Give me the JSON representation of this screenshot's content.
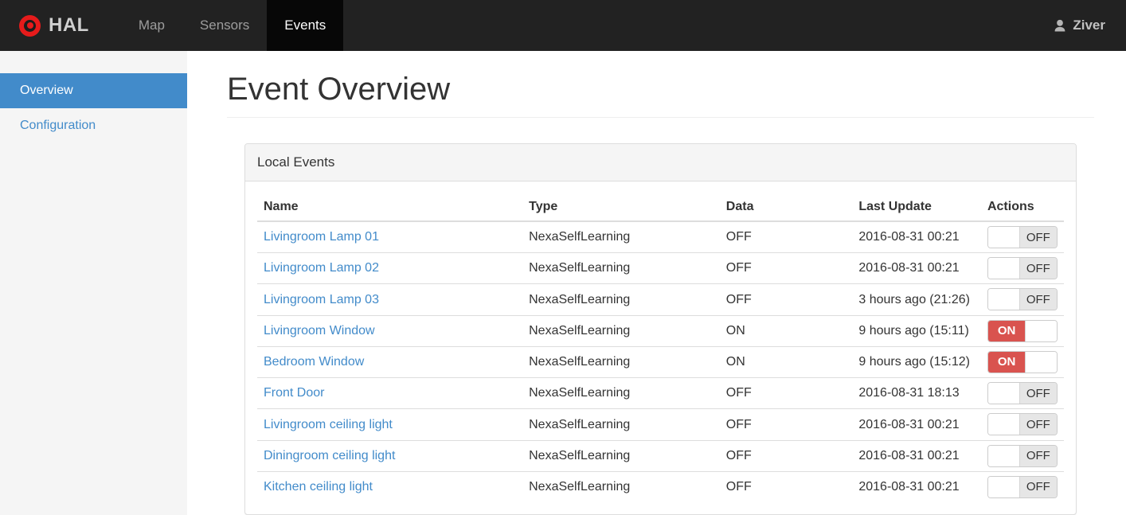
{
  "navbar": {
    "brand": "HAL",
    "items": [
      {
        "label": "Map",
        "active": false
      },
      {
        "label": "Sensors",
        "active": false
      },
      {
        "label": "Events",
        "active": true
      }
    ],
    "user": "Ziver"
  },
  "sidebar": {
    "items": [
      {
        "label": "Overview",
        "active": true
      },
      {
        "label": "Configuration",
        "active": false
      }
    ]
  },
  "main": {
    "title": "Event Overview",
    "panel": {
      "title": "Local Events",
      "table": {
        "headers": [
          "Name",
          "Type",
          "Data",
          "Last Update",
          "Actions"
        ],
        "rows": [
          {
            "name": "Livingroom Lamp 01",
            "type": "NexaSelfLearning",
            "data": "OFF",
            "last_update": "2016-08-31 00:21",
            "switch": "OFF"
          },
          {
            "name": "Livingroom Lamp 02",
            "type": "NexaSelfLearning",
            "data": "OFF",
            "last_update": "2016-08-31 00:21",
            "switch": "OFF"
          },
          {
            "name": "Livingroom Lamp 03",
            "type": "NexaSelfLearning",
            "data": "OFF",
            "last_update": "3 hours ago (21:26)",
            "switch": "OFF"
          },
          {
            "name": "Livingroom Window",
            "type": "NexaSelfLearning",
            "data": "ON",
            "last_update": "9 hours ago (15:11)",
            "switch": "ON"
          },
          {
            "name": "Bedroom Window",
            "type": "NexaSelfLearning",
            "data": "ON",
            "last_update": "9 hours ago (15:12)",
            "switch": "ON"
          },
          {
            "name": "Front Door",
            "type": "NexaSelfLearning",
            "data": "OFF",
            "last_update": "2016-08-31 18:13",
            "switch": "OFF"
          },
          {
            "name": "Livingroom ceiling light",
            "type": "NexaSelfLearning",
            "data": "OFF",
            "last_update": "2016-08-31 00:21",
            "switch": "OFF"
          },
          {
            "name": "Diningroom ceiling light",
            "type": "NexaSelfLearning",
            "data": "OFF",
            "last_update": "2016-08-31 00:21",
            "switch": "OFF"
          },
          {
            "name": "Kitchen ceiling light",
            "type": "NexaSelfLearning",
            "data": "OFF",
            "last_update": "2016-08-31 00:21",
            "switch": "OFF"
          }
        ]
      }
    }
  },
  "icons": {
    "logo": "target-icon",
    "user": "user-icon"
  },
  "colors": {
    "navbar_bg": "#222222",
    "navbar_active_bg": "#070707",
    "nav_link": "#9d9d9d",
    "brand_red": "#e61b1b",
    "sidebar_bg": "#f5f5f5",
    "accent_blue": "#428bca",
    "switch_on_red": "#d9534f",
    "switch_off_gray": "#e6e6e6",
    "border_gray": "#dddddd"
  }
}
